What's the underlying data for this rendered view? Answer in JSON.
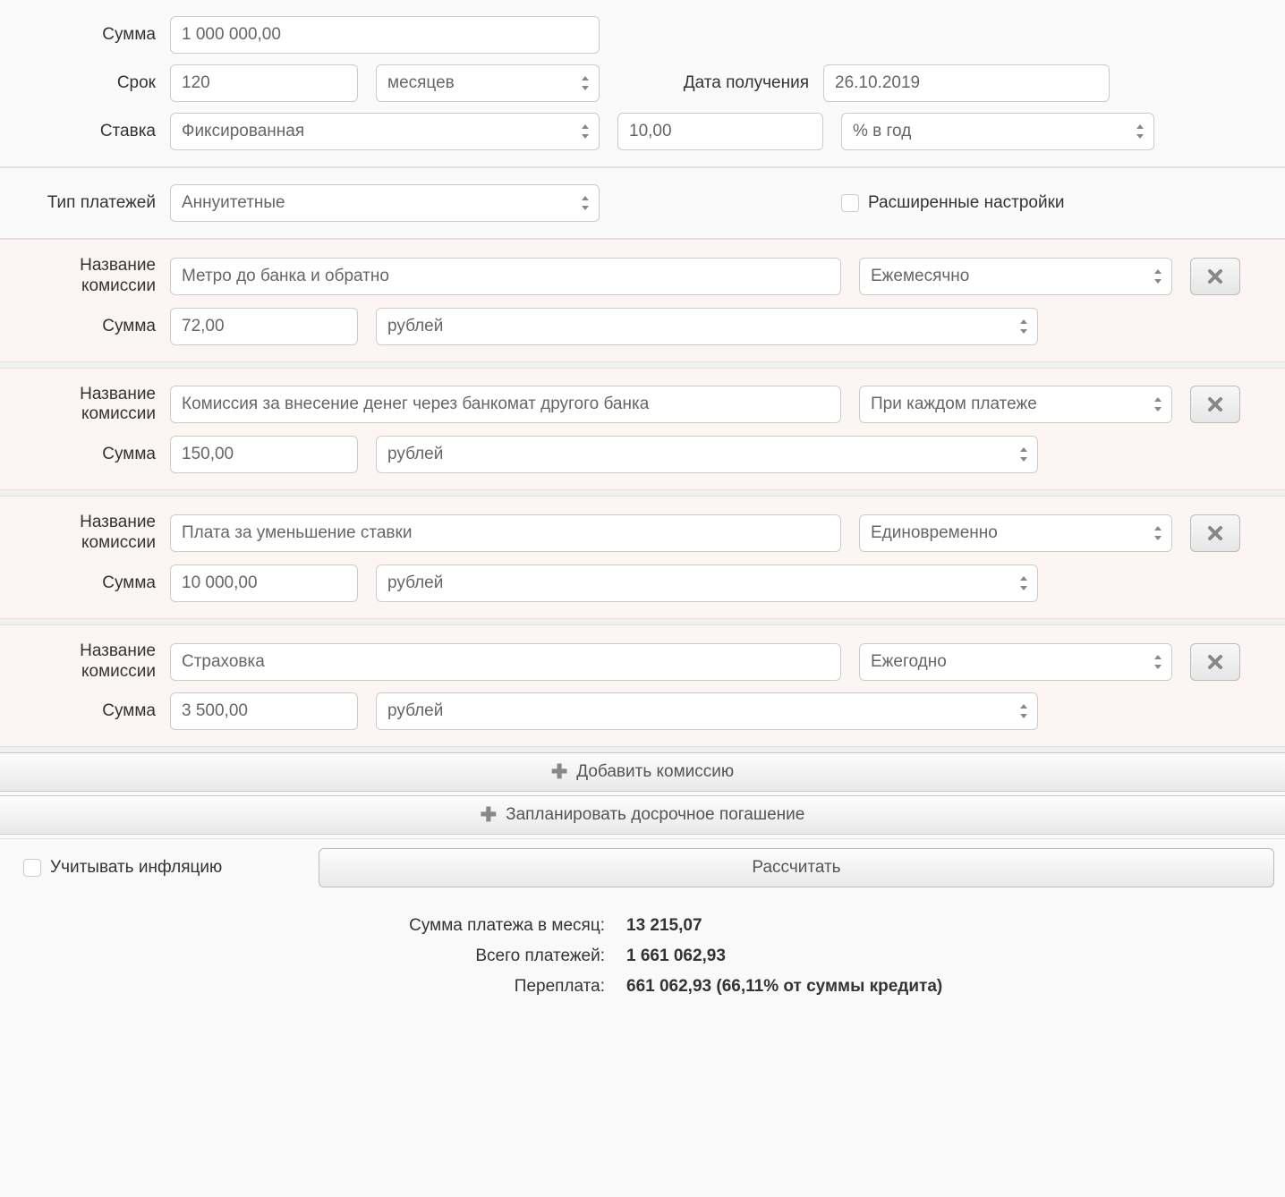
{
  "labels": {
    "amount": "Сумма",
    "term": "Срок",
    "rate": "Ставка",
    "date_received": "Дата получения",
    "payment_type": "Тип платежей",
    "advanced": "Расширенные настройки",
    "commission_name": "Название комиссии",
    "commission_amount": "Сумма",
    "add_commission": "Добавить комиссию",
    "plan_early": "Запланировать досрочное погашение",
    "inflation": "Учитывать инфляцию",
    "calculate": "Рассчитать",
    "monthly_payment": "Сумма платежа в месяц:",
    "total_payments": "Всего платежей:",
    "overpayment": "Переплата:"
  },
  "main": {
    "amount": "1 000 000,00",
    "term": "120",
    "term_unit": "месяцев",
    "date": "26.10.2019",
    "rate_type": "Фиксированная",
    "rate_value": "10,00",
    "rate_unit": "% в год",
    "payment_type": "Аннуитетные"
  },
  "commissions": [
    {
      "name": "Метро до банка и обратно",
      "freq": "Ежемесячно",
      "amount": "72,00",
      "unit": "рублей"
    },
    {
      "name": "Комиссия за внесение денег через банкомат другого банка",
      "freq": "При каждом платеже",
      "amount": "150,00",
      "unit": "рублей"
    },
    {
      "name": "Плата за уменьшение ставки",
      "freq": "Единовременно",
      "amount": "10 000,00",
      "unit": "рублей"
    },
    {
      "name": "Страховка",
      "freq": "Ежегодно",
      "amount": "3 500,00",
      "unit": "рублей"
    }
  ],
  "results": {
    "monthly": "13 215,07",
    "total": "1 661 062,93",
    "overpay": "661 062,93 (66,11% от суммы кредита)"
  }
}
